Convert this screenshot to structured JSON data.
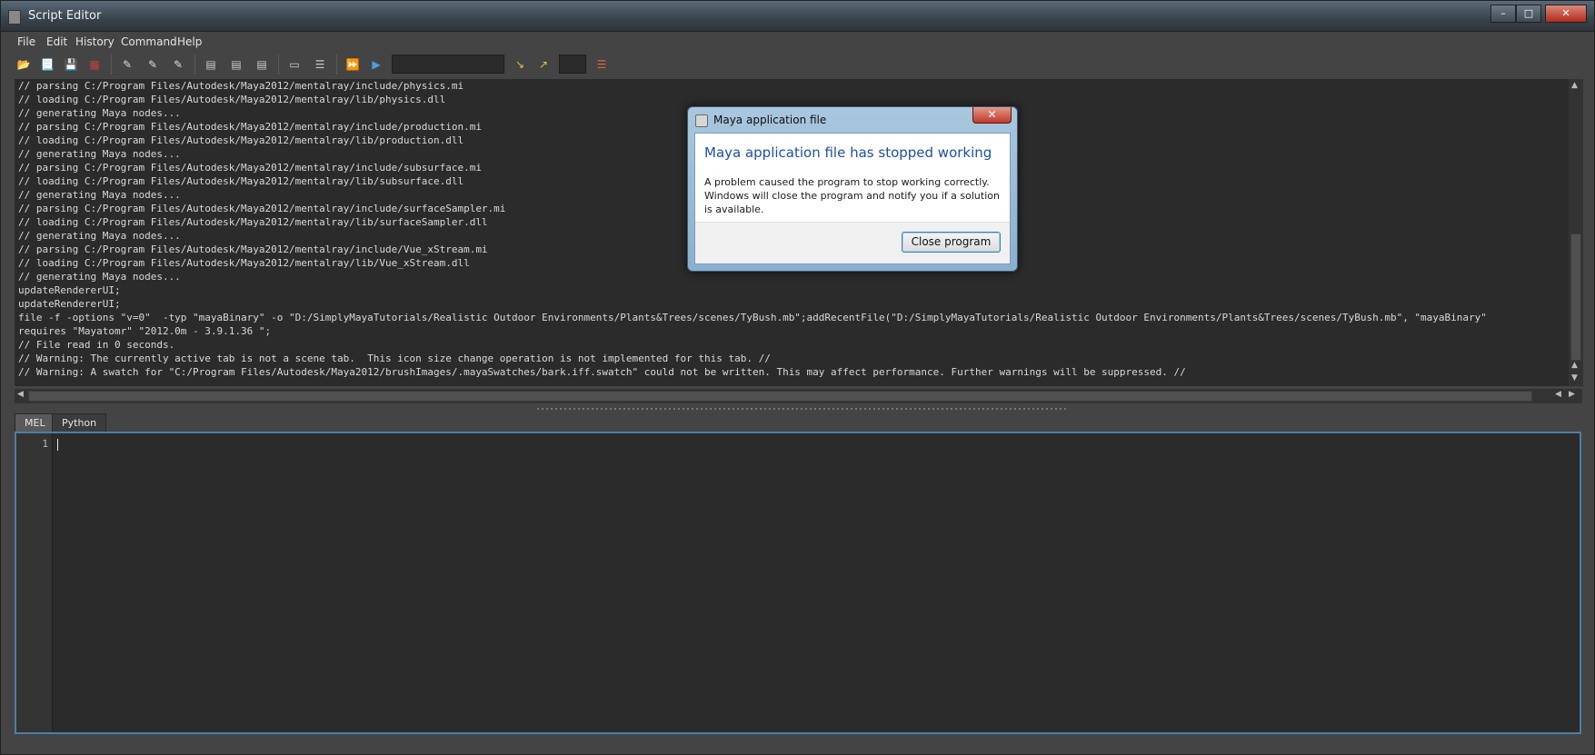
{
  "window": {
    "title": "Script Editor"
  },
  "menu": [
    "File",
    "Edit",
    "History",
    "Command",
    "Help"
  ],
  "output_lines": [
    "// parsing C:/Program Files/Autodesk/Maya2012/mentalray/include/physics.mi",
    "// loading C:/Program Files/Autodesk/Maya2012/mentalray/lib/physics.dll",
    "// generating Maya nodes...",
    "// parsing C:/Program Files/Autodesk/Maya2012/mentalray/include/production.mi",
    "// loading C:/Program Files/Autodesk/Maya2012/mentalray/lib/production.dll",
    "// generating Maya nodes...",
    "// parsing C:/Program Files/Autodesk/Maya2012/mentalray/include/subsurface.mi",
    "// loading C:/Program Files/Autodesk/Maya2012/mentalray/lib/subsurface.dll",
    "// generating Maya nodes...",
    "// parsing C:/Program Files/Autodesk/Maya2012/mentalray/include/surfaceSampler.mi",
    "// loading C:/Program Files/Autodesk/Maya2012/mentalray/lib/surfaceSampler.dll",
    "// generating Maya nodes...",
    "// parsing C:/Program Files/Autodesk/Maya2012/mentalray/include/Vue_xStream.mi",
    "// loading C:/Program Files/Autodesk/Maya2012/mentalray/lib/Vue_xStream.dll",
    "// generating Maya nodes...",
    "updateRendererUI;",
    "updateRendererUI;",
    "file -f -options \"v=0\"  -typ \"mayaBinary\" -o \"D:/SimplyMayaTutorials/Realistic Outdoor Environments/Plants&Trees/scenes/TyBush.mb\";addRecentFile(\"D:/SimplyMayaTutorials/Realistic Outdoor Environments/Plants&Trees/scenes/TyBush.mb\", \"mayaBinary\"",
    "requires \"Mayatomr\" \"2012.0m - 3.9.1.36 \";",
    "// File read in 0 seconds.",
    "// Warning: The currently active tab is not a scene tab.  This icon size change operation is not implemented for this tab. //",
    "// Warning: A swatch for \"C:/Program Files/Autodesk/Maya2012/brushImages/.mayaSwatches/bark.iff.swatch\" could not be written. This may affect performance. Further warnings will be suppressed. //"
  ],
  "tabs": [
    "MEL",
    "Python"
  ],
  "editor": {
    "line_number": "1"
  },
  "dialog": {
    "title": "Maya application file",
    "heading": "Maya application file has stopped working",
    "message": "A problem caused the program to stop working correctly. Windows will close the program and notify you if a solution is available.",
    "close_button": "Close program"
  }
}
